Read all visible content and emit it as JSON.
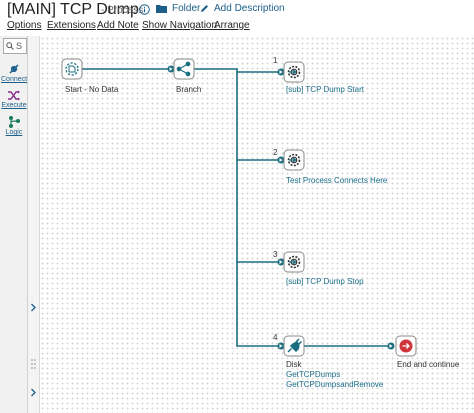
{
  "header": {
    "title": "[MAIN] TCP Dump",
    "subtitle": "- Process",
    "folder_label": "Folder",
    "add_description_label": "Add Description"
  },
  "menu": {
    "options": "Options",
    "extensions": "Extensions",
    "add_note": "Add Note",
    "show_navigation": "Show Navigation",
    "arrange": "Arrange"
  },
  "left_panel": {
    "search_placeholder": "S",
    "tools": [
      {
        "label": "Connect",
        "icon": "plug-icon"
      },
      {
        "label": "Execute",
        "icon": "shuffle-icon"
      },
      {
        "label": "Logic",
        "icon": "branch-icon"
      }
    ]
  },
  "shapes": {
    "start": {
      "label": "Start - No Data"
    },
    "branch": {
      "label": "Branch"
    },
    "sub1": {
      "number": "1",
      "label": "[sub] TCP Dump Start"
    },
    "sub2": {
      "number": "2",
      "label": "Test Process Connects Here"
    },
    "sub3": {
      "number": "3",
      "label": "[sub] TCP Dump Stop"
    },
    "disk": {
      "number": "4",
      "label_line1": "Disk",
      "label_line2": "GetTCPDumps",
      "label_line3": "GetTCPDumpsandRemove"
    },
    "end": {
      "label": "End and continue"
    }
  },
  "colors": {
    "connector": "#1a6e80",
    "link": "#1b6f8a",
    "end_red": "#d0343b"
  }
}
